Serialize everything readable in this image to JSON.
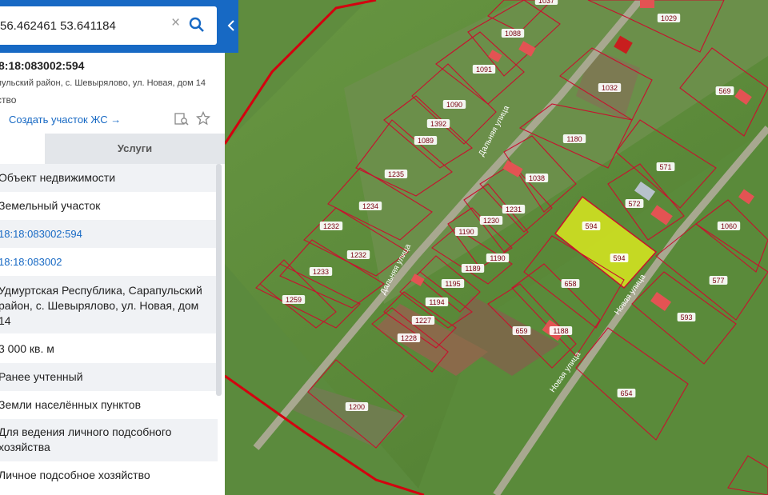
{
  "search": {
    "value": "56.462461 53.641184"
  },
  "parcel": {
    "title": "8:18:083002:594",
    "address_short": "пульский район, с. Шевырялово, ул. Новая, дом 14",
    "type_short": "ство",
    "create_link": "Создать участок ЖС →"
  },
  "tabs": {
    "services": "Услуги"
  },
  "rows": [
    "Объект недвижимости",
    "Земельный участок",
    "18:18:083002:594",
    "18:18:083002",
    "Удмуртская Республика, Сарапульский район, с. Шевырялово, ул. Новая, дом 14",
    "3 000 кв. м",
    "Ранее учтенный",
    "Земли населённых пунктов",
    "Для ведения личного подсобного хозяйства",
    "Личное подсобное хозяйство"
  ],
  "map": {
    "parcels": [
      "1037",
      "1029",
      "1088",
      "1091",
      "1032",
      "1090",
      "1392",
      "569",
      "1089",
      "1180",
      "1235",
      "571",
      "1038",
      "572",
      "1231",
      "594",
      "1060",
      "1234",
      "1230",
      "1232",
      "1190",
      "594",
      "577",
      "1190",
      "1232",
      "1189",
      "1233",
      "658",
      "1195",
      "1259",
      "593",
      "1194",
      "1227",
      "1188",
      "659",
      "1228",
      "654",
      "1200"
    ],
    "streets": [
      "Дальняя улица",
      "Дальняя улица",
      "Новая улица",
      "Новая улица"
    ]
  },
  "colors": {
    "accent": "#1769c4",
    "boundary": "#d4000f",
    "parcel": "#c8102e",
    "selected": "#d8e620"
  }
}
